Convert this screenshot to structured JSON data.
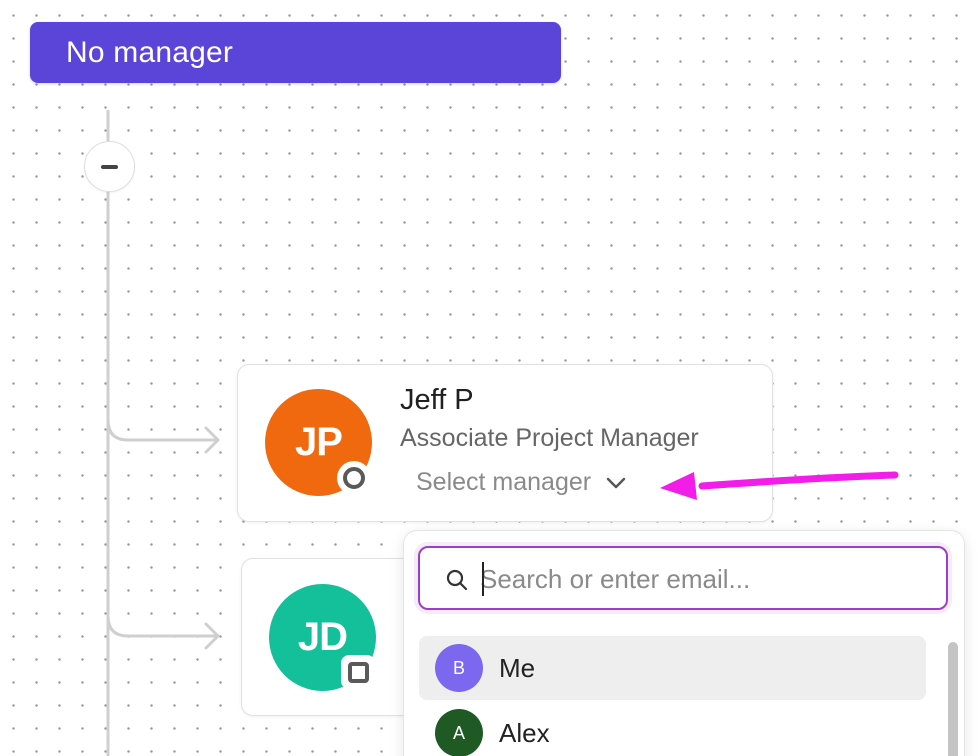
{
  "root_node": {
    "label": "No manager",
    "color": "#5b45d9"
  },
  "collapse_button": {
    "icon": "minus-icon"
  },
  "cards": [
    {
      "initials": "JP",
      "avatar_color": "#f0690f",
      "status_icon": "circle-status-icon",
      "name": "Jeff P",
      "title": "Associate Project Manager",
      "manager_select_label": "Select manager"
    },
    {
      "initials": "JD",
      "avatar_color": "#13c09a",
      "status_icon": "square-status-icon"
    }
  ],
  "annotation": {
    "arrow_color": "#f21de8"
  },
  "dropdown": {
    "search": {
      "placeholder": "Search or enter email...",
      "value": ""
    },
    "options": [
      {
        "initial": "B",
        "label": "Me",
        "avatar_color": "#7b68ee",
        "highlighted": true
      },
      {
        "initial": "A",
        "label": "Alex",
        "avatar_color": "#1f5a24",
        "highlighted": false
      }
    ]
  }
}
